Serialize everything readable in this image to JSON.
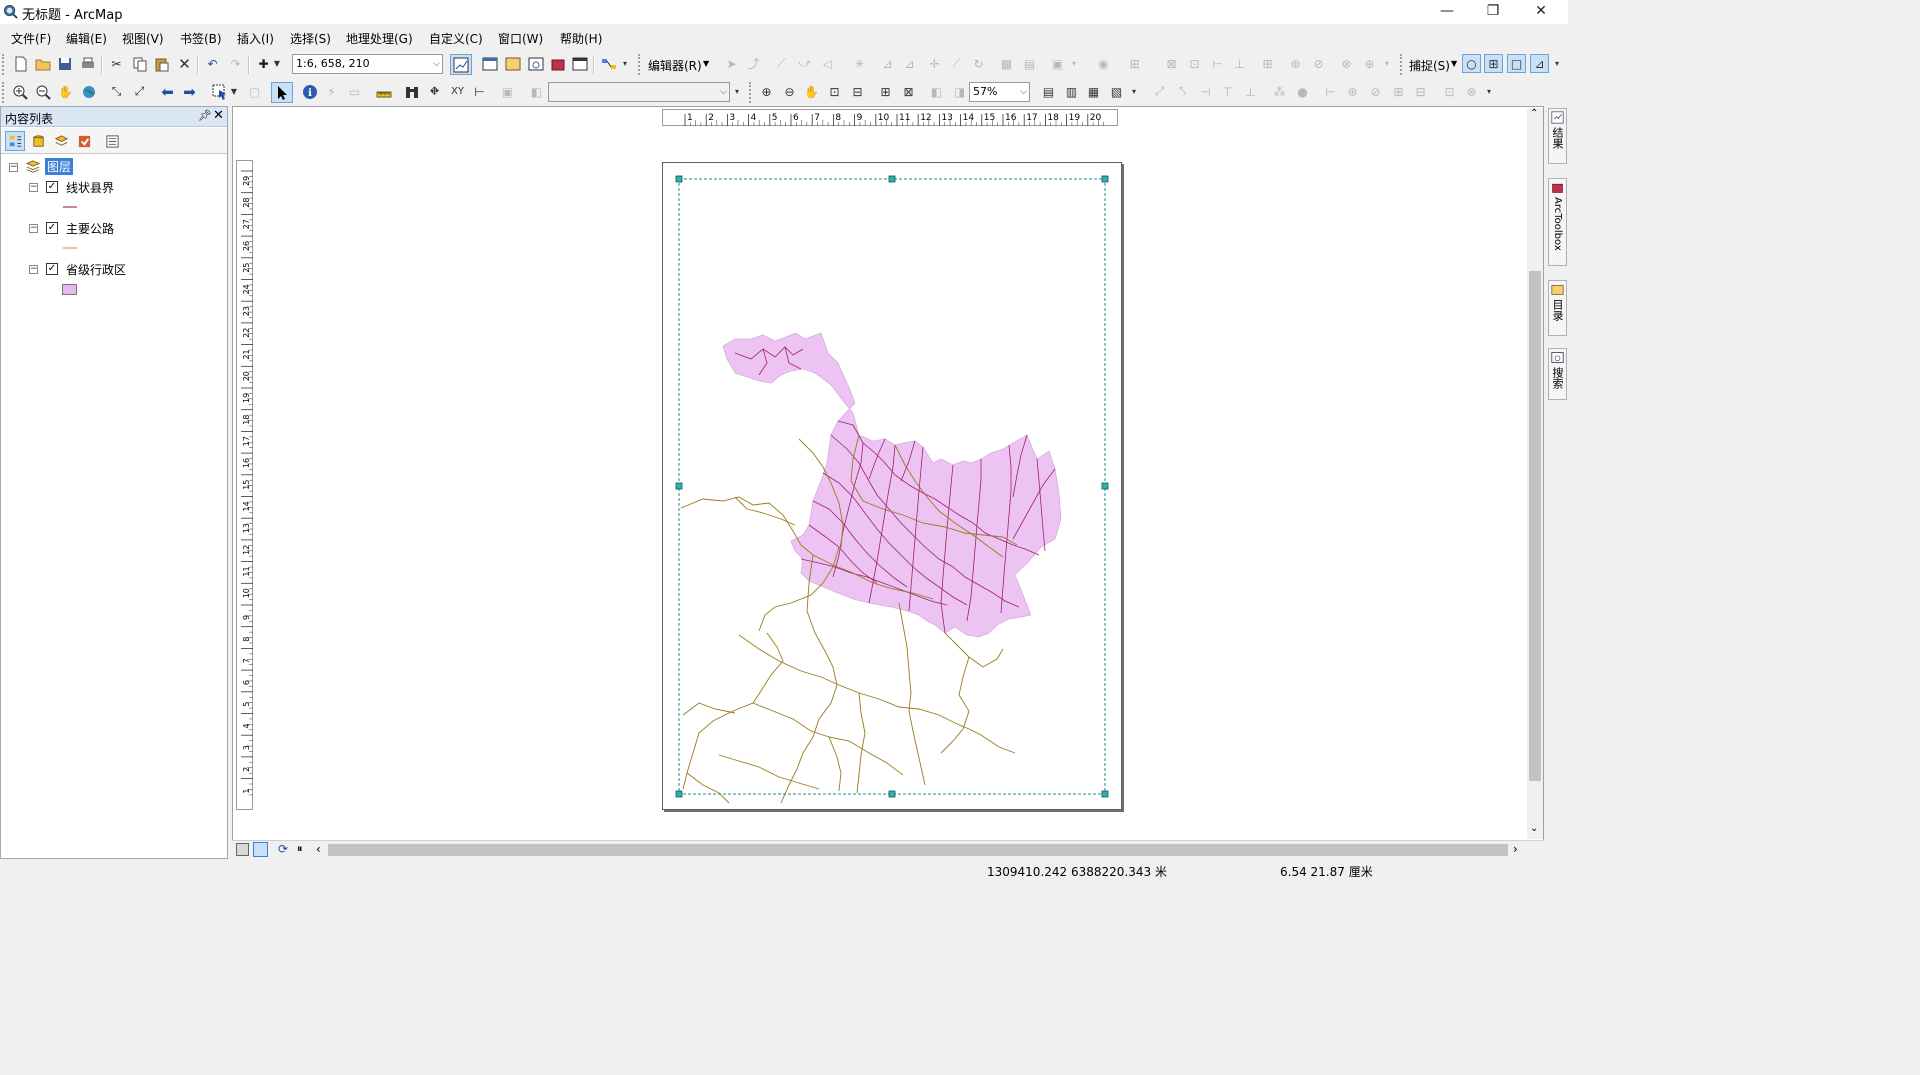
{
  "window": {
    "title": "无标题 - ArcMap"
  },
  "menu": [
    "文件(F)",
    "编辑(E)",
    "视图(V)",
    "书签(B)",
    "插入(I)",
    "选择(S)",
    "地理处理(G)",
    "自定义(C)",
    "窗口(W)",
    "帮助(H)"
  ],
  "toolbar": {
    "scale_value": "1:6, 658, 210",
    "editor_label": "编辑器(R)",
    "snapping_label": "捕捉(S)",
    "zoom_value": "57%"
  },
  "toc": {
    "title": "内容列表",
    "data_frame": "图层",
    "layers": [
      {
        "name": "线状县界",
        "checked": true,
        "symbol_color": "#b03060",
        "symbol": "line"
      },
      {
        "name": "主要公路",
        "checked": true,
        "symbol_color": "#c8a070",
        "symbol": "line"
      },
      {
        "name": "省级行政区",
        "checked": true,
        "symbol_color": "#e8b8f0",
        "symbol": "fill"
      }
    ]
  },
  "rulers": {
    "horizontal": [
      "1",
      "2",
      "3",
      "4",
      "5",
      "6",
      "7",
      "8",
      "9",
      "10",
      "11",
      "12",
      "13",
      "14",
      "15",
      "16",
      "17",
      "18",
      "19",
      "20"
    ],
    "vertical": [
      "29",
      "28",
      "27",
      "26",
      "25",
      "24",
      "23",
      "22",
      "21",
      "20",
      "19",
      "18",
      "17",
      "16",
      "15",
      "14",
      "13",
      "12",
      "11",
      "10",
      "9",
      "8",
      "7",
      "6",
      "5",
      "4",
      "3",
      "2",
      "1"
    ]
  },
  "dock_tabs": [
    "结果",
    "ArcToolbox",
    "目录",
    "搜索"
  ],
  "status": {
    "map_coordinates": "1309410.242  6388220.343 米",
    "page_coordinates": "6.54  21.87 厘米"
  },
  "colors": {
    "province_fill": "#edc3f3",
    "county_line": "#a0206a",
    "road_line": "#9a7a1a",
    "selection": "#1e8a8a"
  }
}
